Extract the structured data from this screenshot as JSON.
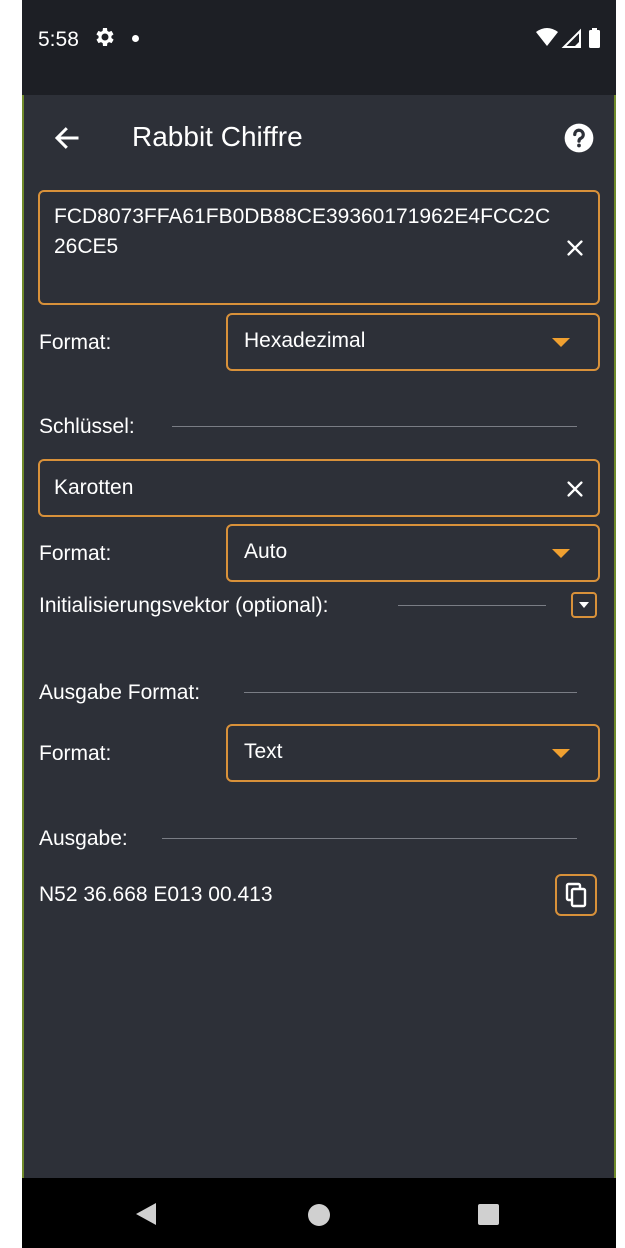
{
  "status_bar": {
    "time": "5:58",
    "icons": [
      "gear-icon",
      "dot-icon",
      "wifi-icon",
      "signal-icon",
      "battery-icon"
    ]
  },
  "app_bar": {
    "title": "Rabbit Chiffre",
    "back_icon": "arrow-left-icon",
    "help_icon": "help-circle-icon"
  },
  "input": {
    "value": "FCD8073FFA61FB0DB88CE39360171962E4FCC2C26CE5",
    "format_label": "Format:",
    "format_value": "Hexadezimal"
  },
  "key": {
    "section_label": "Schlüssel:",
    "value": "Karotten",
    "format_label": "Format:",
    "format_value": "Auto"
  },
  "iv": {
    "section_label": "Initialisierungsvektor (optional):"
  },
  "output_format": {
    "section_label": "Ausgabe Format:",
    "format_label": "Format:",
    "format_value": "Text"
  },
  "output": {
    "section_label": "Ausgabe:",
    "value": "N52 36.668 E013 00.413",
    "copy_icon": "copy-icon"
  },
  "nav_bar": {
    "icons": [
      "nav-back-icon",
      "nav-home-icon",
      "nav-recents-icon"
    ]
  },
  "colors": {
    "background": "#2d3038",
    "status_bar": "#1d1f25",
    "accent": "#d8913a",
    "arrow": "#f0a030",
    "text": "#ffffff"
  }
}
